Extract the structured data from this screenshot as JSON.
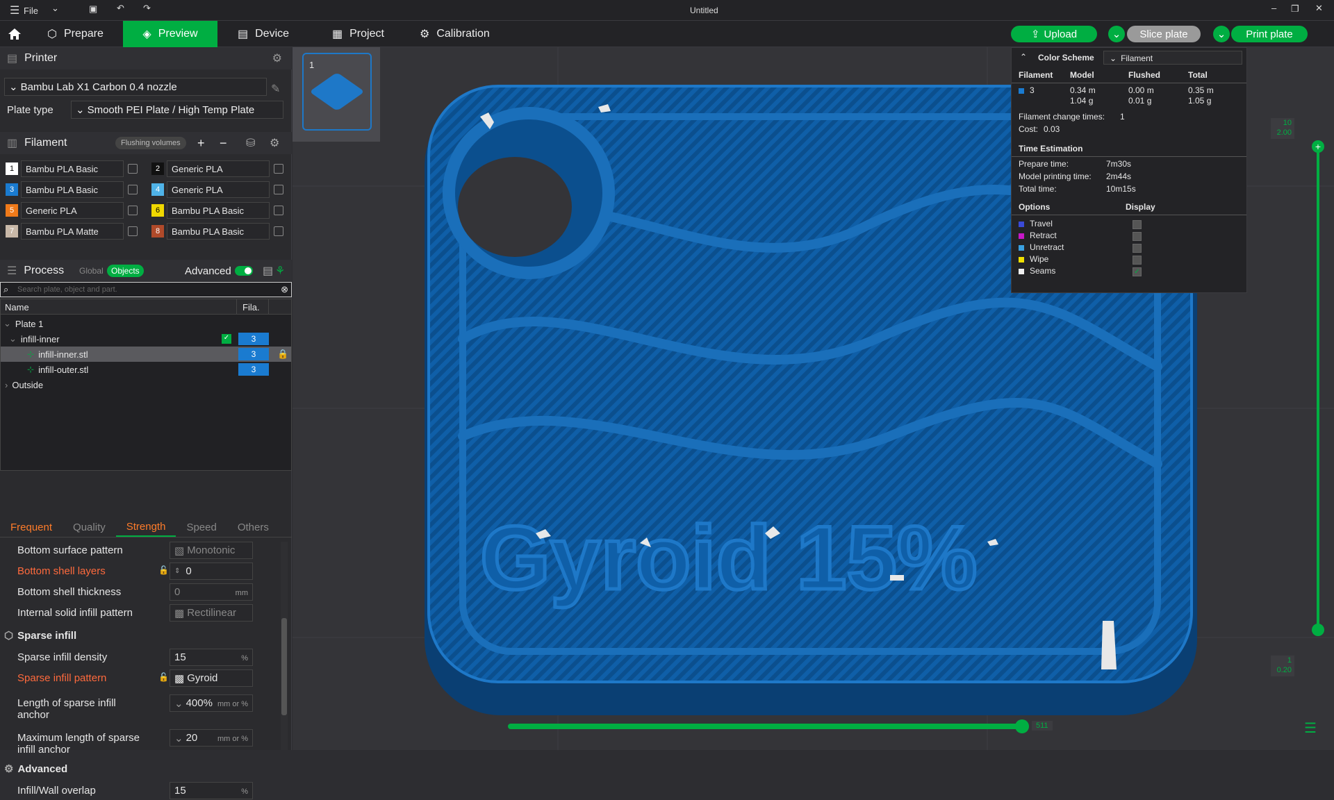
{
  "titlebar": {
    "menu": "File",
    "title": "Untitled"
  },
  "nav": {
    "tabs": [
      "Prepare",
      "Preview",
      "Device",
      "Project",
      "Calibration"
    ],
    "upload": "Upload",
    "slice": "Slice plate",
    "print": "Print plate"
  },
  "printer": {
    "title": "Printer",
    "model": "Bambu Lab X1 Carbon 0.4 nozzle",
    "plate_type_label": "Plate type",
    "plate_type": "Smooth PEI Plate / High Temp Plate"
  },
  "filament": {
    "title": "Filament",
    "flushing": "Flushing volumes",
    "items": [
      {
        "num": "1",
        "name": "Bambu PLA Basic",
        "color": "#ffffff",
        "text": "#000"
      },
      {
        "num": "2",
        "name": "Generic PLA",
        "color": "#111111",
        "text": "#fff"
      },
      {
        "num": "3",
        "name": "Bambu PLA Basic",
        "color": "#1a7bd0",
        "text": "#fff"
      },
      {
        "num": "4",
        "name": "Generic PLA",
        "color": "#4fb3e8",
        "text": "#fff"
      },
      {
        "num": "5",
        "name": "Generic PLA",
        "color": "#f07a1a",
        "text": "#fff"
      },
      {
        "num": "6",
        "name": "Bambu PLA Basic",
        "color": "#f0d800",
        "text": "#000"
      },
      {
        "num": "7",
        "name": "Bambu PLA Matte",
        "color": "#c8b8a8",
        "text": "#fff"
      },
      {
        "num": "8",
        "name": "Bambu PLA Basic",
        "color": "#b04a2a",
        "text": "#fff"
      }
    ]
  },
  "process": {
    "title": "Process",
    "global": "Global",
    "objects": "Objects",
    "advanced": "Advanced",
    "search_placeholder": "Search plate, object and part."
  },
  "tree": {
    "col_name": "Name",
    "col_fila": "Fila.",
    "plate": "Plate 1",
    "obj": "infill-inner",
    "part1": "infill-inner.stl",
    "part2": "infill-outer.stl",
    "outside": "Outside",
    "fila_val": "3"
  },
  "ptabs": [
    "Frequent",
    "Quality",
    "Strength",
    "Speed",
    "Others"
  ],
  "params": {
    "bottom_surface_pattern": {
      "label": "Bottom surface pattern",
      "value": "Monotonic"
    },
    "bottom_shell_layers": {
      "label": "Bottom shell layers",
      "value": "0"
    },
    "bottom_shell_thickness": {
      "label": "Bottom shell thickness",
      "value": "0",
      "unit": "mm"
    },
    "internal_solid": {
      "label": "Internal solid infill pattern",
      "value": "Rectilinear"
    },
    "sparse_header": "Sparse infill",
    "sparse_density": {
      "label": "Sparse infill density",
      "value": "15",
      "unit": "%"
    },
    "sparse_pattern": {
      "label": "Sparse infill pattern",
      "value": "Gyroid"
    },
    "anchor_len": {
      "label": "Length of sparse infill anchor",
      "value": "400%",
      "unit": "mm or %"
    },
    "anchor_max": {
      "label": "Maximum length of sparse infill anchor",
      "value": "20",
      "unit": "mm or %"
    },
    "advanced_header": "Advanced",
    "overlap": {
      "label": "Infill/Wall overlap",
      "value": "15",
      "unit": "%"
    }
  },
  "plate_thumb": {
    "num": "1"
  },
  "legend": {
    "color_scheme": "Color Scheme",
    "scheme": "Filament",
    "cols": [
      "Filament",
      "Model",
      "Flushed",
      "Total"
    ],
    "row": {
      "id": "3",
      "model_m": "0.34 m",
      "model_g": "1.04 g",
      "flushed_m": "0.00 m",
      "flushed_g": "0.01 g",
      "total_m": "0.35 m",
      "total_g": "1.05 g"
    },
    "change_label": "Filament change times:",
    "change_val": "1",
    "cost_label": "Cost:",
    "cost_val": "0.03",
    "time_header": "Time Estimation",
    "prepare_label": "Prepare time:",
    "prepare_val": "7m30s",
    "model_label": "Model printing time:",
    "model_val": "2m44s",
    "total_label": "Total time:",
    "total_val": "10m15s",
    "options": "Options",
    "display": "Display",
    "opts": [
      {
        "name": "Travel",
        "color": "#3a4ad8",
        "checked": false
      },
      {
        "name": "Retract",
        "color": "#c818c8",
        "checked": false
      },
      {
        "name": "Unretract",
        "color": "#3aa0e0",
        "checked": false
      },
      {
        "name": "Wipe",
        "color": "#f0e000",
        "checked": false
      },
      {
        "name": "Seams",
        "color": "#f0f0f0",
        "checked": true
      }
    ]
  },
  "slider": {
    "top_a": "10",
    "top_b": "2.00",
    "bot_a": "1",
    "bot_b": "0.20",
    "h_val": "511"
  },
  "model_text": "Gyroid 15%",
  "colors": {
    "accent": "#00ae42",
    "model": "#0f5fa8",
    "model_dark": "#0a3f73"
  }
}
